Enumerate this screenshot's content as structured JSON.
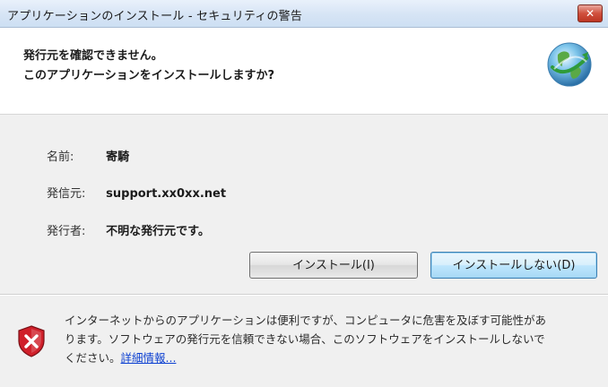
{
  "window": {
    "title": "アプリケーションのインストール - セキュリティの警告",
    "close_glyph": "✕"
  },
  "header": {
    "line1": "発行元を確認できません。",
    "line2": "このアプリケーションをインストールしますか?",
    "icon": "globe-icon"
  },
  "details": {
    "name_label": "名前:",
    "name_value": "寄騎",
    "source_label": "発信元:",
    "source_value": "support.xx0xx.net",
    "publisher_label": "発行者:",
    "publisher_value": "不明な発行元です。"
  },
  "buttons": {
    "install": "インストール(I)",
    "dont_install": "インストールしない(D)"
  },
  "footer": {
    "icon": "shield-warning-icon",
    "line1": "インターネットからのアプリケーションは便利ですが、コンピュータに危害を及ぼす可能性があ",
    "line2": "ります。ソフトウェアの発行元を信頼できない場合、このソフトウェアをインストールしないで",
    "line3": "ください。",
    "link": "詳細情報..."
  },
  "colors": {
    "link": "#0b3fd1",
    "shield_red": "#d0202a"
  }
}
